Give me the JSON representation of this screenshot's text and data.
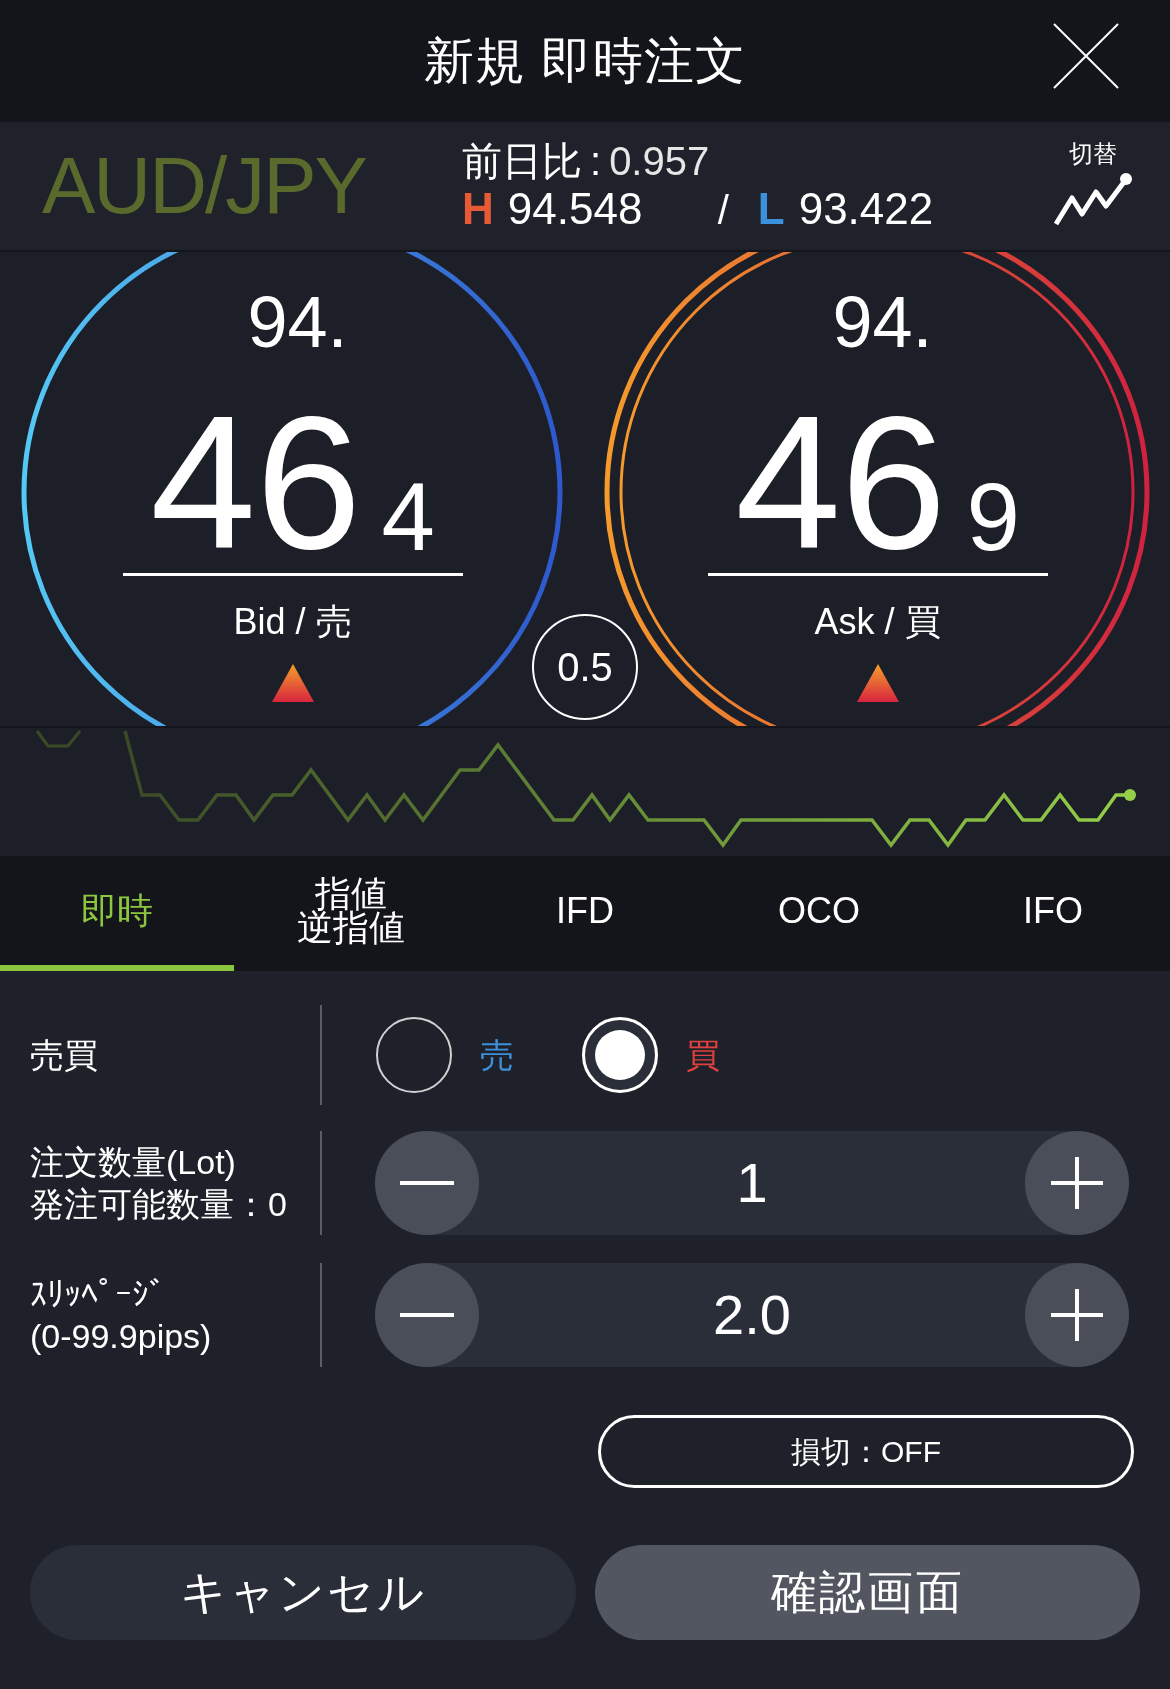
{
  "header": {
    "title": "新規 即時注文"
  },
  "rate": {
    "pair": "AUD/JPY",
    "change_label": "前日比",
    "change_sep": ":",
    "change": "0.957",
    "high_mark": "H",
    "high": "94.548",
    "separator": "/",
    "low_mark": "L",
    "low": "93.422",
    "switch_label": "切替"
  },
  "quotes": [
    {
      "kind": "bid",
      "head": "94.",
      "big": "46",
      "pip": "4",
      "label": "Bid / 売"
    },
    {
      "kind": "ask",
      "head": "94.",
      "big": "46",
      "pip": "9",
      "label": "Ask / 買"
    }
  ],
  "spread": "0.5",
  "tabs": [
    {
      "label": "即時",
      "selected": true
    },
    {
      "label": "指値",
      "label_2": "逆指値",
      "selected": false
    },
    {
      "label": "IFD",
      "selected": false
    },
    {
      "label": "OCO",
      "selected": false
    },
    {
      "label": "IFO",
      "selected": false
    }
  ],
  "side": {
    "label": "売買",
    "options": [
      {
        "label": "売",
        "color": "#3d8fd8",
        "selected": false
      },
      {
        "label": "買",
        "color": "#e0413f",
        "selected": true
      }
    ]
  },
  "steppers": [
    {
      "label": "注文数量(Lot)",
      "sublabel": "発注可能数量：0",
      "value": "1"
    },
    {
      "label": "ｽﾘｯﾍﾟｰｼﾞ",
      "sublabel": "(0-99.9pips)",
      "value": "2.0"
    }
  ],
  "stop_loss": "損切：OFF",
  "buttons": [
    {
      "label": "キャンセル",
      "kind": "secondary"
    },
    {
      "label": "確認画面",
      "kind": "primary"
    }
  ]
}
